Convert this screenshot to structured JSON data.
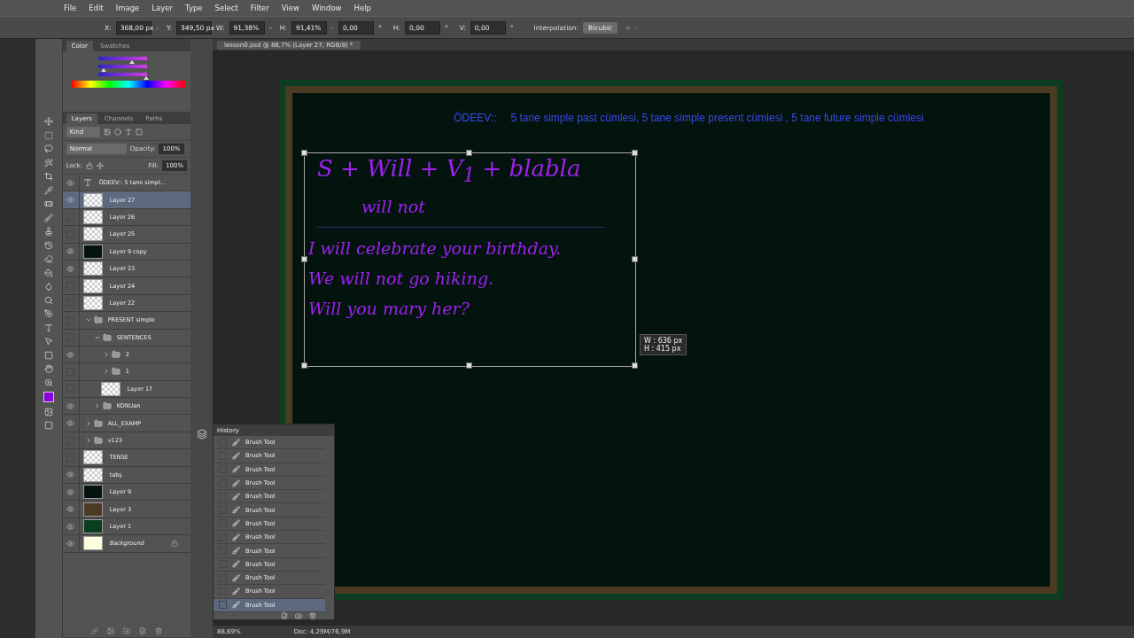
{
  "menu": [
    "File",
    "Edit",
    "Image",
    "Layer",
    "Type",
    "Select",
    "Filter",
    "View",
    "Window",
    "Help"
  ],
  "options": [
    {
      "kind": "plain",
      "label": "X:",
      "value": "368,00 px"
    },
    {
      "kind": "delta",
      "label": "Y:",
      "value": "349,50 px"
    },
    {
      "kind": "plain",
      "label": "W:",
      "value": "91,38%"
    },
    {
      "kind": "linked",
      "label": "H:",
      "value": "91,41%"
    },
    {
      "kind": "angle",
      "value": "0,00",
      "unit": "°"
    },
    {
      "kind": "plain",
      "label": "H:",
      "value": "0,00",
      "unit": "°"
    },
    {
      "kind": "plain",
      "label": "V:",
      "value": "0,00",
      "unit": "°"
    }
  ],
  "interpolation": {
    "label": "Interpolation:",
    "value": "Bicubic"
  },
  "document_tab": "lesson0.psd @ 88,7% (Layer 27, RGB/8) *",
  "color_panel": {
    "tabs": [
      {
        "label": "Color",
        "selected": true
      },
      {
        "label": "Swatches",
        "selected": false
      }
    ],
    "sliders": [
      {
        "level": 0.7
      },
      {
        "level": 0.12
      },
      {
        "level": 0.98
      }
    ]
  },
  "layers_panel": {
    "tabs": [
      {
        "label": "Layers",
        "selected": true
      },
      {
        "label": "Channels",
        "selected": false
      },
      {
        "label": "Paths",
        "selected": false
      }
    ],
    "filter": "Kind",
    "blend_mode": "Normal",
    "opacity_label": "Opacity:",
    "opacity": "100%",
    "lock_label": "Lock:",
    "fill_label": "Fill:",
    "fill": "100%",
    "layers": [
      {
        "kind": "text",
        "name": "ÖDEEV::  5 tane simpl...",
        "visible": true,
        "selected": false
      },
      {
        "kind": "layer",
        "name": "Layer 27",
        "visible": true,
        "selected": true
      },
      {
        "kind": "layer",
        "name": "Layer 26",
        "visible": false,
        "selected": false
      },
      {
        "kind": "layer",
        "name": "Layer 25",
        "visible": false,
        "selected": false
      },
      {
        "kind": "layer",
        "name": "Layer 9 copy",
        "visible": true,
        "selected": false,
        "color": "#03140e"
      },
      {
        "kind": "layer",
        "name": "Layer 23",
        "visible": true,
        "selected": false
      },
      {
        "kind": "layer",
        "name": "Layer 24",
        "visible": false,
        "selected": false
      },
      {
        "kind": "layer",
        "name": "Layer 22",
        "visible": false,
        "selected": false
      },
      {
        "kind": "group",
        "name": "PRESENT simple",
        "visible": false,
        "selected": false,
        "expanded": true,
        "children": [
          {
            "kind": "group",
            "name": "SENTENCES",
            "visible": false,
            "selected": false,
            "expanded": true,
            "children": [
              {
                "kind": "group",
                "name": "2",
                "visible": true,
                "selected": false,
                "expanded": false
              },
              {
                "kind": "group",
                "name": "1",
                "visible": false,
                "selected": false,
                "expanded": false
              },
              {
                "kind": "layer",
                "name": "Layer 17",
                "visible": false,
                "selected": false
              }
            ]
          },
          {
            "kind": "group",
            "name": "KONUan",
            "visible": true,
            "selected": false,
            "expanded": false
          }
        ]
      },
      {
        "kind": "group",
        "name": "ALL_EXAMP",
        "visible": true,
        "selected": false,
        "expanded": false
      },
      {
        "kind": "group",
        "name": "v123",
        "visible": false,
        "selected": false,
        "expanded": false
      },
      {
        "kind": "layer",
        "name": "TENSE",
        "visible": false,
        "selected": false
      },
      {
        "kind": "layer",
        "name": "tabş",
        "visible": true,
        "selected": false
      },
      {
        "kind": "layer",
        "name": "Layer 9",
        "visible": true,
        "selected": false,
        "color": "#03140e"
      },
      {
        "kind": "layer",
        "name": "Layer 3",
        "visible": true,
        "selected": false,
        "color": "#4a3b22"
      },
      {
        "kind": "layer",
        "name": "Layer 1",
        "visible": true,
        "selected": false,
        "color": "#0b3d20"
      },
      {
        "kind": "background",
        "name": "Background",
        "visible": true,
        "selected": false,
        "color": "#fdfde0"
      }
    ]
  },
  "history": {
    "title": "History",
    "items": [
      {
        "label": "Brush Tool",
        "selected": false
      },
      {
        "label": "Brush Tool",
        "selected": false
      },
      {
        "label": "Brush Tool",
        "selected": false
      },
      {
        "label": "Brush Tool",
        "selected": false
      },
      {
        "label": "Brush Tool",
        "selected": false
      },
      {
        "label": "Brush Tool",
        "selected": false
      },
      {
        "label": "Brush Tool",
        "selected": false
      },
      {
        "label": "Brush Tool",
        "selected": false
      },
      {
        "label": "Brush Tool",
        "selected": false
      },
      {
        "label": "Brush Tool",
        "selected": false
      },
      {
        "label": "Brush Tool",
        "selected": false
      },
      {
        "label": "Brush Tool",
        "selected": false
      },
      {
        "label": "Brush Tool",
        "selected": true
      }
    ]
  },
  "canvas": {
    "heading_label": "ÖDEEV::",
    "heading": "5 tane simple past cümlesi, 5 tane simple present cümlesi , 5 tane future simple cümlesi",
    "handwriting": [
      "S + Will + V$_{1}$ + blabla",
      "will not",
      "I will celebrate your birthday.",
      "We will not go hiking.",
      "Will you mary her?"
    ],
    "size_readout": [
      "W :  636 px",
      "H :  415 px"
    ]
  },
  "status_bar": {
    "zoom": "88,69%",
    "doc": "Doc: 4,29M/76,9M"
  }
}
